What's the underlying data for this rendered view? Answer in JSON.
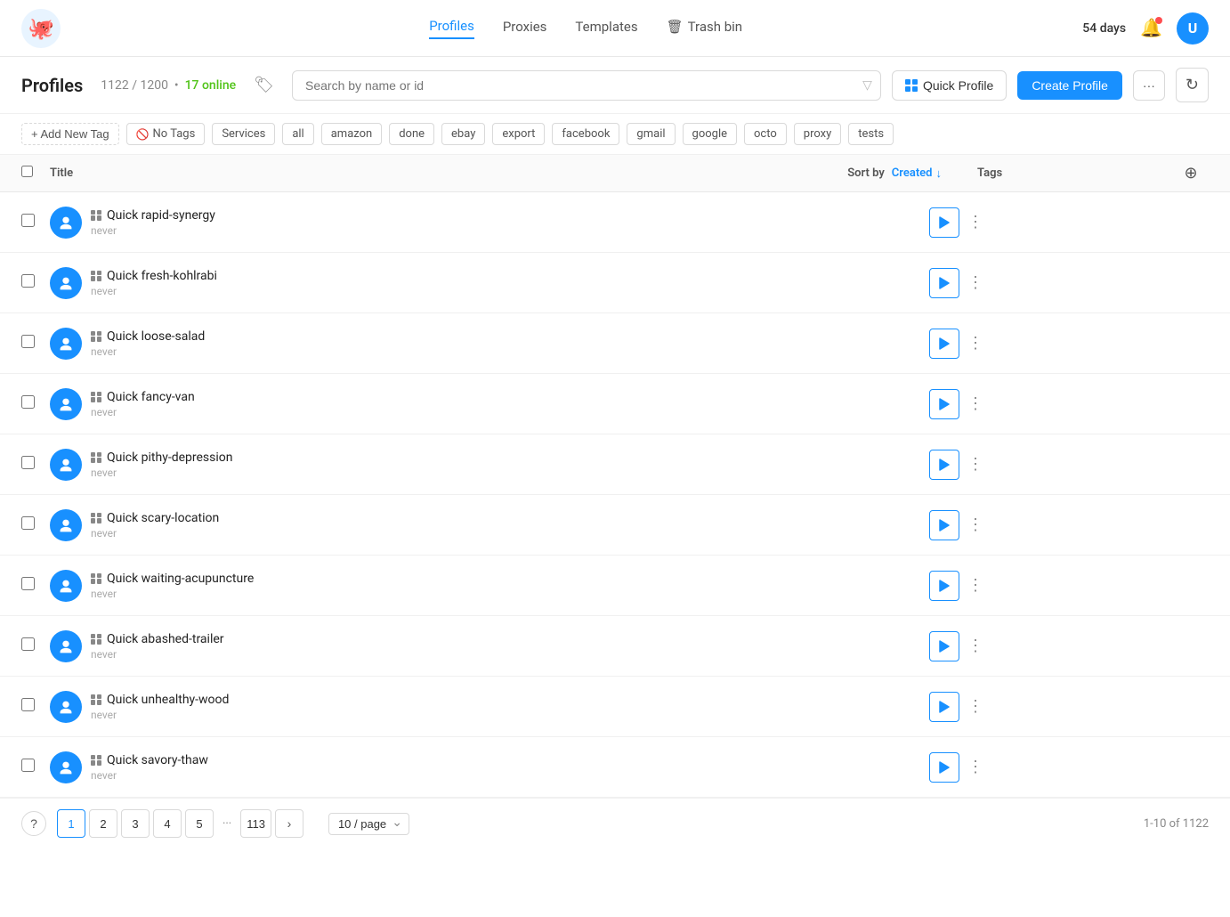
{
  "nav": {
    "links": [
      {
        "id": "profiles",
        "label": "Profiles",
        "active": true
      },
      {
        "id": "proxies",
        "label": "Proxies",
        "active": false
      },
      {
        "id": "templates",
        "label": "Templates",
        "active": false
      },
      {
        "id": "trashbin",
        "label": "Trash bin",
        "active": false
      }
    ],
    "days": "54 days",
    "avatar_initial": "U"
  },
  "subheader": {
    "title": "Profiles",
    "count_used": "1122",
    "count_total": "1200",
    "online_count": "17 online",
    "search_placeholder": "Search by name or id",
    "quick_profile_label": "Quick Profile",
    "create_profile_label": "Create Profile"
  },
  "tags": {
    "add_label": "+ Add New Tag",
    "items": [
      {
        "id": "no-tags",
        "label": "No Tags",
        "has_icon": true
      },
      {
        "id": "services",
        "label": "Services"
      },
      {
        "id": "all",
        "label": "all"
      },
      {
        "id": "amazon",
        "label": "amazon"
      },
      {
        "id": "done",
        "label": "done"
      },
      {
        "id": "ebay",
        "label": "ebay"
      },
      {
        "id": "export",
        "label": "export"
      },
      {
        "id": "facebook",
        "label": "facebook"
      },
      {
        "id": "gmail",
        "label": "gmail"
      },
      {
        "id": "google",
        "label": "google"
      },
      {
        "id": "octo",
        "label": "octo"
      },
      {
        "id": "proxy",
        "label": "proxy"
      },
      {
        "id": "tests",
        "label": "tests"
      }
    ]
  },
  "table": {
    "sort_label": "Sort by",
    "sort_field": "Created",
    "col_title": "Title",
    "col_tags": "Tags",
    "profiles": [
      {
        "id": 1,
        "name": "Quick rapid-synergy",
        "sub": "never"
      },
      {
        "id": 2,
        "name": "Quick fresh-kohlrabi",
        "sub": "never"
      },
      {
        "id": 3,
        "name": "Quick loose-salad",
        "sub": "never"
      },
      {
        "id": 4,
        "name": "Quick fancy-van",
        "sub": "never"
      },
      {
        "id": 5,
        "name": "Quick pithy-depression",
        "sub": "never"
      },
      {
        "id": 6,
        "name": "Quick scary-location",
        "sub": "never"
      },
      {
        "id": 7,
        "name": "Quick waiting-acupuncture",
        "sub": "never"
      },
      {
        "id": 8,
        "name": "Quick abashed-trailer",
        "sub": "never"
      },
      {
        "id": 9,
        "name": "Quick unhealthy-wood",
        "sub": "never"
      },
      {
        "id": 10,
        "name": "Quick savory-thaw",
        "sub": "never"
      }
    ]
  },
  "pagination": {
    "current": 1,
    "pages": [
      1,
      2,
      3,
      4,
      5
    ],
    "last_page": 113,
    "per_page": "10 / page",
    "total": "1-10 of 1122",
    "help_label": "?"
  },
  "colors": {
    "brand_blue": "#1890ff",
    "online_green": "#52c41a"
  }
}
